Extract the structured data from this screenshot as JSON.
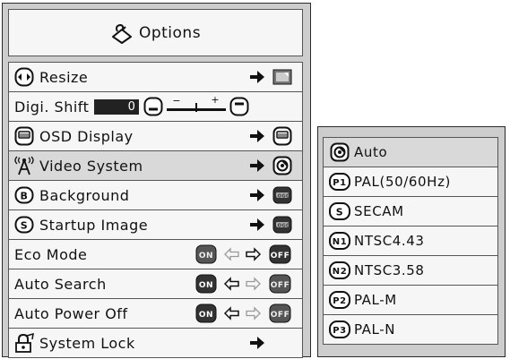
{
  "options_menu": {
    "title": "Options",
    "title_icon": "options-icon",
    "items": [
      {
        "label": "Resize",
        "icon": "resize-icon",
        "type": "submenu",
        "target_icon": "resize-screen-icon"
      },
      {
        "label": "Digi. Shift",
        "type": "slider",
        "value": "0",
        "range_marks": [
          "−",
          "+"
        ]
      },
      {
        "label": "OSD Display",
        "icon": "osd-display-icon",
        "type": "submenu",
        "target_icon": "osd-display-icon"
      },
      {
        "label": "Video System",
        "icon": "video-system-icon",
        "type": "submenu",
        "target_icon": "auto-icon",
        "selected": true
      },
      {
        "label": "Background",
        "icon": "background-b-icon",
        "type": "submenu",
        "target_icon": "logo-icon"
      },
      {
        "label": "Startup Image",
        "icon": "startup-s-icon",
        "type": "submenu",
        "target_icon": "logo-icon"
      },
      {
        "label": "Eco Mode",
        "type": "toggle",
        "on": "ON",
        "off": "OFF",
        "state": "OFF"
      },
      {
        "label": "Auto Search",
        "type": "toggle",
        "on": "ON",
        "off": "OFF",
        "state": "ON"
      },
      {
        "label": "Auto Power Off",
        "type": "toggle",
        "on": "ON",
        "off": "OFF",
        "state": "ON"
      },
      {
        "label": "System Lock",
        "icon": "system-lock-icon",
        "type": "submenu"
      }
    ]
  },
  "video_system_menu": {
    "items": [
      {
        "code": "",
        "label": "Auto",
        "icon": "auto-icon",
        "selected": true
      },
      {
        "code": "P1",
        "label": "PAL(50/60Hz)"
      },
      {
        "code": "S",
        "label": "SECAM"
      },
      {
        "code": "N1",
        "label": "NTSC4.43"
      },
      {
        "code": "N2",
        "label": "NTSC3.58"
      },
      {
        "code": "P2",
        "label": "PAL-M"
      },
      {
        "code": "P3",
        "label": "PAL-N"
      }
    ]
  },
  "colors": {
    "panel": "#cdcdcd",
    "row": "#f6f6f6",
    "selected_row": "#d9d9d9",
    "border": "#2a2a2a",
    "badge": "#333333"
  }
}
